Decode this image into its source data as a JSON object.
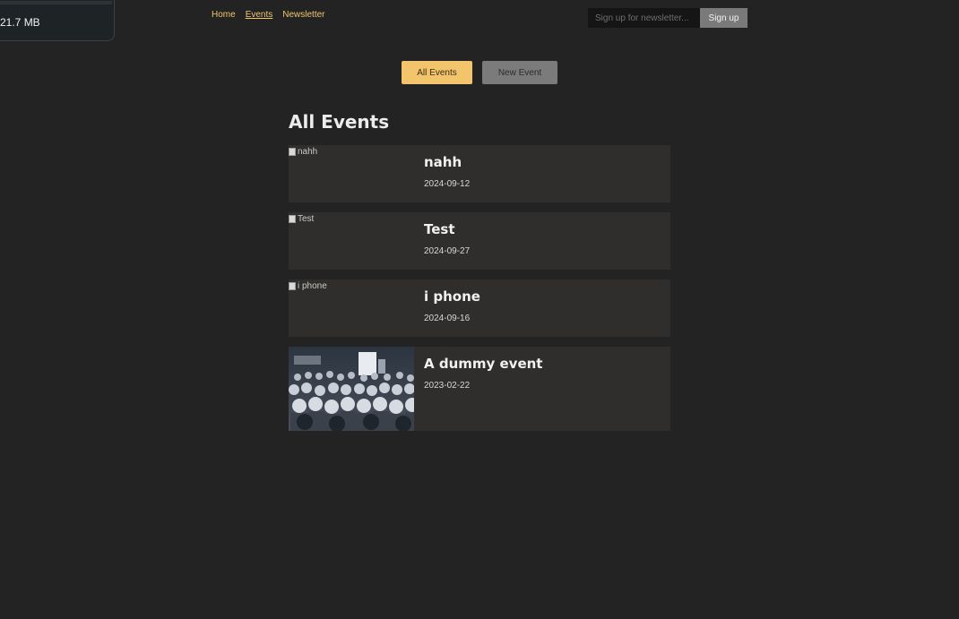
{
  "overlay": {
    "memory": "21.7 MB"
  },
  "nav": {
    "items": [
      {
        "label": "Home"
      },
      {
        "label": "Events",
        "active": true
      },
      {
        "label": "Newsletter"
      }
    ]
  },
  "newsletter": {
    "placeholder": "Sign up for newsletter...",
    "button_label": "Sign up"
  },
  "actions": {
    "all_events_label": "All Events",
    "new_event_label": "New Event"
  },
  "section_title": "All Events",
  "events": [
    {
      "title": "nahh",
      "date": "2024-09-12",
      "image_alt": "nahh"
    },
    {
      "title": "Test",
      "date": "2024-09-27",
      "image_alt": "Test"
    },
    {
      "title": "i phone",
      "date": "2024-09-16",
      "image_alt": "i phone"
    },
    {
      "title": "A dummy event",
      "date": "2023-02-22",
      "image_alt": "A dummy event"
    }
  ],
  "colors": {
    "accent": "#f2c46c",
    "background": "#232323",
    "card": "#302e2c",
    "secondary_button": "#7b7b7b"
  }
}
